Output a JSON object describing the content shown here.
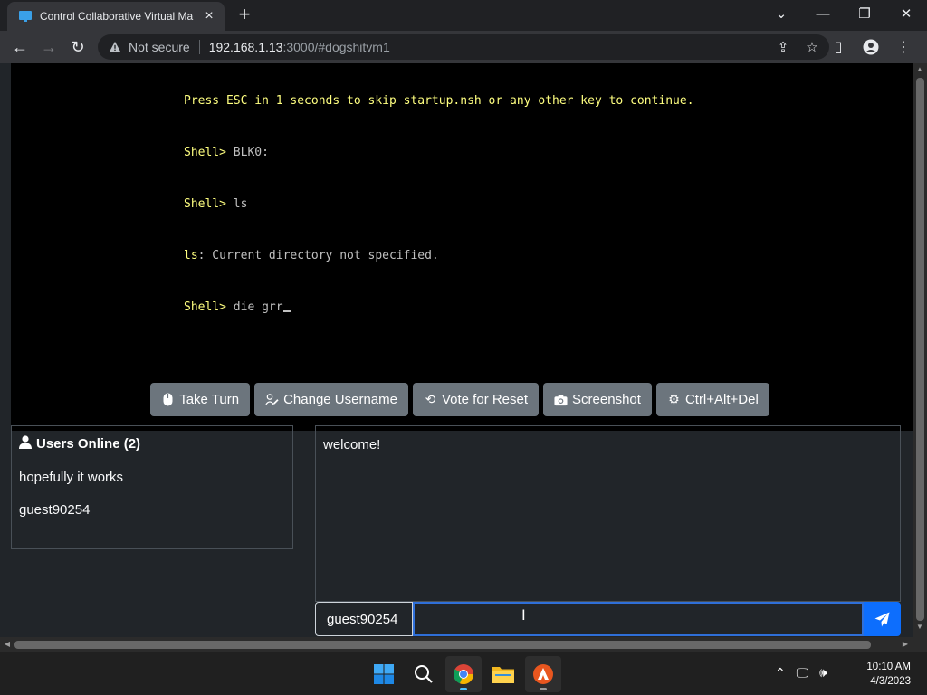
{
  "browser": {
    "tab_title": "Control Collaborative Virtual Ma",
    "new_tab_symbol": "+",
    "security_label": "Not secure",
    "url_host": "192.168.1.13",
    "url_rest": ":3000/#dogshitvm1"
  },
  "terminal": {
    "lines": [
      {
        "prompt": "",
        "text": "Press ESC in 1 seconds to skip startup.nsh or any other key to continue."
      },
      {
        "prompt": "Shell>",
        "text": " BLK0:"
      },
      {
        "prompt": "Shell>",
        "text": " ls"
      },
      {
        "prompt": "ls",
        "text": ": Current directory not specified."
      },
      {
        "prompt": "Shell>",
        "text": " die grr"
      }
    ]
  },
  "actions": {
    "take_turn": "Take Turn",
    "change_username": "Change Username",
    "vote_reset": "Vote for Reset",
    "screenshot": "Screenshot",
    "ctrl_alt_del": "Ctrl+Alt+Del"
  },
  "users": {
    "title": "Users Online (2)",
    "list": [
      "hopefully it works",
      "guest90254"
    ]
  },
  "chat": {
    "messages": [
      "welcome!"
    ],
    "username": "guest90254",
    "input_value": ""
  },
  "clock": {
    "time": "10:10 AM",
    "date": "4/3/2023"
  },
  "colors": {
    "accent": "#0d6efd",
    "button": "#6c757d",
    "page_bg": "#212529",
    "terminal_prompt": "#ffff80"
  }
}
